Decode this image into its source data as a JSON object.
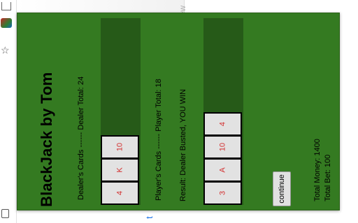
{
  "browser": {
    "partial_tab_text": "iew",
    "partial_link_char": "t"
  },
  "game": {
    "title": "BlackJack by Tom",
    "dealer_caption": "Dealer's Cards ------ Dealer Total: 24",
    "player_caption": "Player's Cards ------ Player Total: 18",
    "result_caption": "Result: Dealer Busted, YOU WIN",
    "money_caption": "Total Money: 1400",
    "bet_caption": "Total Bet: 100",
    "continue_label": "continue",
    "dealer_cards": [
      "4",
      "K",
      "10"
    ],
    "player_cards": [
      "3",
      "A",
      "10",
      "4"
    ],
    "colors": {
      "table": "#347a21",
      "hand_zone": "#265a18",
      "card_face": "#e2e2e2",
      "card_rank": "#d32f2f"
    }
  }
}
